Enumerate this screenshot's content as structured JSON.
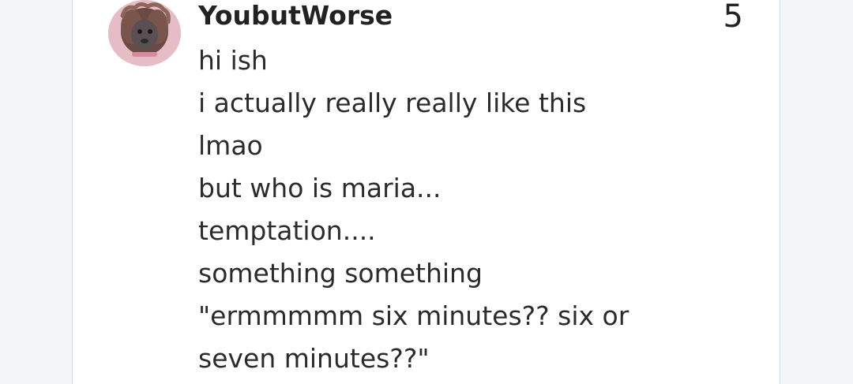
{
  "comment": {
    "username": "YoubutWorse",
    "count": "5",
    "avatar_icon": "user-avatar-icon",
    "lines": [
      "hi ish",
      "i actually really really like this",
      "lmao",
      "but who is maria...",
      "temptation....",
      "something something",
      "\"ermmmmm six minutes?? six or",
      "seven minutes??\""
    ]
  },
  "colors": {
    "background": "#f4f5f7",
    "card": "#ffffff",
    "text": "#222222",
    "avatar_bg": "#e3b9c4"
  }
}
